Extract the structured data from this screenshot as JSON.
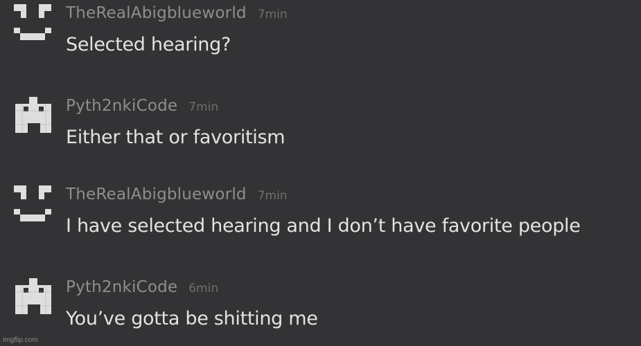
{
  "messages": [
    {
      "author": "TheRealAbigblueworld",
      "time": "7min",
      "text": "Selected hearing?",
      "avatar_icon": "smiley-pixel-icon"
    },
    {
      "author": "Pyth2nkiCode",
      "time": "7min",
      "text": "Either that or favoritism",
      "avatar_icon": "invader-pixel-icon"
    },
    {
      "author": "TheRealAbigblueworld",
      "time": "7min",
      "text": "I have selected hearing and I don’t have favorite people",
      "avatar_icon": "smiley-pixel-icon"
    },
    {
      "author": "Pyth2nkiCode",
      "time": "6min",
      "text": "You’ve gotta be shitting me",
      "avatar_icon": "invader-pixel-icon"
    }
  ],
  "watermark": "imgflip.com",
  "colors": {
    "background": "#333335",
    "author": "#8e8e8e",
    "time": "#6f6f6f",
    "text": "#e3e3e3",
    "avatar": "#dedede"
  }
}
